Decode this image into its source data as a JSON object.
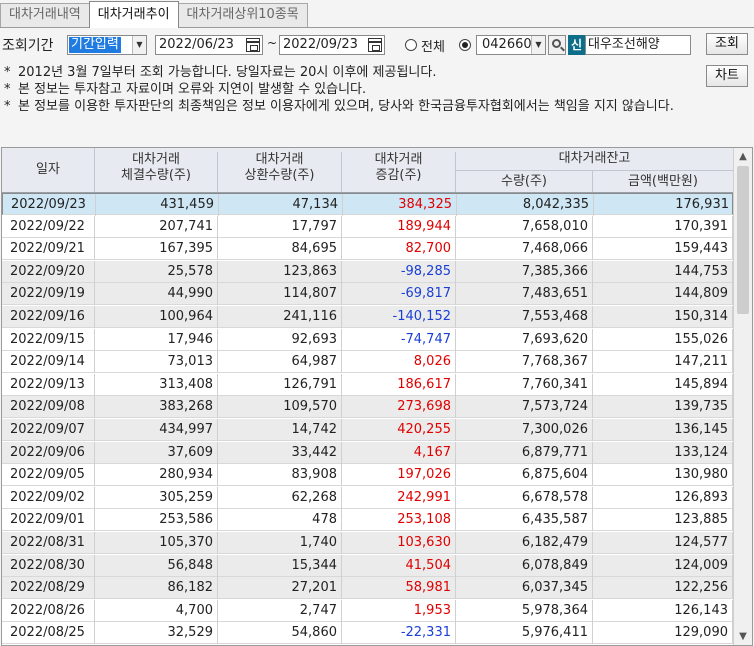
{
  "tabs": [
    {
      "label": "대차거래내역",
      "active": false
    },
    {
      "label": "대차거래추이",
      "active": true
    },
    {
      "label": "대차거래상위10종목",
      "active": false
    }
  ],
  "filter": {
    "period_label": "조회기간",
    "period_mode": "기간입력",
    "start_date": "2022/06/23",
    "tilde": "~",
    "end_date": "2022/09/23",
    "radio_all": "전체",
    "radio_all_selected": false,
    "radio_code_selected": true,
    "code": "042660",
    "new_badge": "신",
    "stock_name": "대우조선해양",
    "search_button": "조회",
    "chart_button": "차트"
  },
  "notes": [
    "2012년 3월 7일부터 조회 가능합니다. 당일자료는 20시 이후에 제공됩니다.",
    "본 정보는 투자참고 자료이며 오류와 지연이 발생할 수 있습니다.",
    "본 정보를 이용한 투자판단의 최종책임은 정보 이용자에게 있으며, 당사와 한국금융투자협회에서는 책임을 지지 않습니다."
  ],
  "note_star": "*",
  "table": {
    "headers": {
      "date": "일자",
      "exec_line1": "대차거래",
      "exec_line2": "체결수량(주)",
      "repay_line1": "대차거래",
      "repay_line2": "상환수량(주)",
      "change_line1": "대차거래",
      "change_line2": "증감(주)",
      "balance_group": "대차거래잔고",
      "balance_qty": "수량(주)",
      "balance_amt": "금액(백만원)"
    },
    "rows": [
      {
        "date": "2022/09/23",
        "exec": "431,459",
        "repay": "47,134",
        "change": "384,325",
        "qty": "8,042,335",
        "amt": "176,931"
      },
      {
        "date": "2022/09/22",
        "exec": "207,741",
        "repay": "17,797",
        "change": "189,944",
        "qty": "7,658,010",
        "amt": "170,391"
      },
      {
        "date": "2022/09/21",
        "exec": "167,395",
        "repay": "84,695",
        "change": "82,700",
        "qty": "7,468,066",
        "amt": "159,443"
      },
      {
        "date": "2022/09/20",
        "exec": "25,578",
        "repay": "123,863",
        "change": "-98,285",
        "qty": "7,385,366",
        "amt": "144,753"
      },
      {
        "date": "2022/09/19",
        "exec": "44,990",
        "repay": "114,807",
        "change": "-69,817",
        "qty": "7,483,651",
        "amt": "144,809"
      },
      {
        "date": "2022/09/16",
        "exec": "100,964",
        "repay": "241,116",
        "change": "-140,152",
        "qty": "7,553,468",
        "amt": "150,314"
      },
      {
        "date": "2022/09/15",
        "exec": "17,946",
        "repay": "92,693",
        "change": "-74,747",
        "qty": "7,693,620",
        "amt": "155,026"
      },
      {
        "date": "2022/09/14",
        "exec": "73,013",
        "repay": "64,987",
        "change": "8,026",
        "qty": "7,768,367",
        "amt": "147,211"
      },
      {
        "date": "2022/09/13",
        "exec": "313,408",
        "repay": "126,791",
        "change": "186,617",
        "qty": "7,760,341",
        "amt": "145,894"
      },
      {
        "date": "2022/09/08",
        "exec": "383,268",
        "repay": "109,570",
        "change": "273,698",
        "qty": "7,573,724",
        "amt": "139,735"
      },
      {
        "date": "2022/09/07",
        "exec": "434,997",
        "repay": "14,742",
        "change": "420,255",
        "qty": "7,300,026",
        "amt": "136,145"
      },
      {
        "date": "2022/09/06",
        "exec": "37,609",
        "repay": "33,442",
        "change": "4,167",
        "qty": "6,879,771",
        "amt": "133,124"
      },
      {
        "date": "2022/09/05",
        "exec": "280,934",
        "repay": "83,908",
        "change": "197,026",
        "qty": "6,875,604",
        "amt": "130,980"
      },
      {
        "date": "2022/09/02",
        "exec": "305,259",
        "repay": "62,268",
        "change": "242,991",
        "qty": "6,678,578",
        "amt": "126,893"
      },
      {
        "date": "2022/09/01",
        "exec": "253,586",
        "repay": "478",
        "change": "253,108",
        "qty": "6,435,587",
        "amt": "123,885"
      },
      {
        "date": "2022/08/31",
        "exec": "105,370",
        "repay": "1,740",
        "change": "103,630",
        "qty": "6,182,479",
        "amt": "124,577"
      },
      {
        "date": "2022/08/30",
        "exec": "56,848",
        "repay": "15,344",
        "change": "41,504",
        "qty": "6,078,849",
        "amt": "124,009"
      },
      {
        "date": "2022/08/29",
        "exec": "86,182",
        "repay": "27,201",
        "change": "58,981",
        "qty": "6,037,345",
        "amt": "122,256"
      },
      {
        "date": "2022/08/26",
        "exec": "4,700",
        "repay": "2,747",
        "change": "1,953",
        "qty": "5,978,364",
        "amt": "126,143"
      },
      {
        "date": "2022/08/25",
        "exec": "32,529",
        "repay": "54,860",
        "change": "-22,331",
        "qty": "5,976,411",
        "amt": "129,090"
      }
    ],
    "selected_row": 0,
    "colors": {
      "positive": "#e00000",
      "negative": "#1a3fd6",
      "selected_row": "#cfe6f4",
      "shaded_row": "#ebebeb",
      "header": "#e7eaf0"
    }
  },
  "scrollbar": {
    "up_arrow": "▲",
    "down_arrow": "▼"
  },
  "dropdown_arrow": "▼"
}
